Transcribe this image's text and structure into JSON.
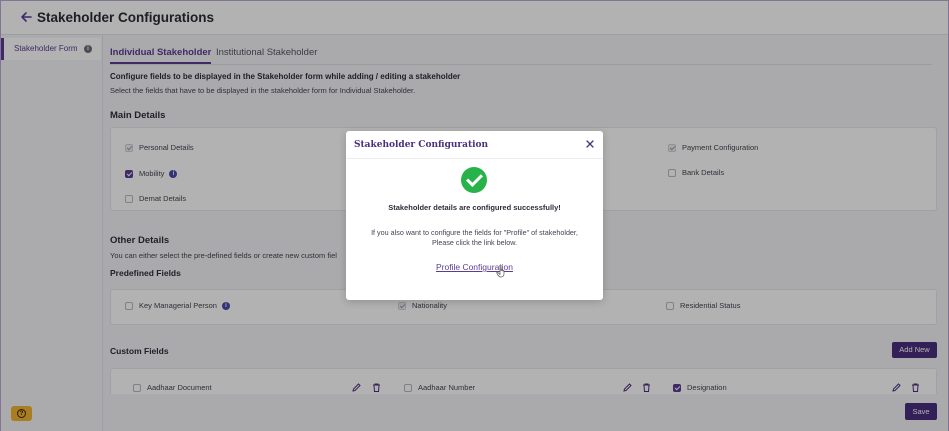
{
  "header": {
    "title": "Stakeholder Configurations"
  },
  "sidebar": {
    "items": [
      {
        "label": "Stakeholder Form"
      }
    ]
  },
  "tabs": [
    {
      "label": "Individual Stakeholder",
      "active": true
    },
    {
      "label": "Institutional Stakeholder",
      "active": false
    }
  ],
  "intro": {
    "title": "Configure fields to be displayed in the Stakeholder form while adding / editing a stakeholder",
    "subtitle": "Select the fields that have to be displayed in the stakeholder form for Individual Stakeholder."
  },
  "main_details": {
    "title": "Main Details",
    "fields": [
      {
        "label": "Personal Details",
        "state": "disabled"
      },
      {
        "label": "Mobility",
        "state": "checked",
        "info": true
      },
      {
        "label": "Demat Details",
        "state": "unchecked"
      },
      {
        "label": "Payment Configuration",
        "state": "disabled"
      },
      {
        "label": "Bank Details",
        "state": "unchecked"
      }
    ]
  },
  "other_details": {
    "title": "Other Details",
    "subtitle": "You can either select the pre-defined fields or create new custom fiel",
    "predefined_title": "Predefined Fields",
    "predefined": [
      {
        "label": "Key Managerial Person",
        "state": "unchecked",
        "info": true
      },
      {
        "label": "Nationality",
        "state": "disabled"
      },
      {
        "label": "Residential Status",
        "state": "unchecked"
      }
    ]
  },
  "custom_fields": {
    "title": "Custom Fields",
    "add_label": "Add New",
    "items": [
      {
        "label": "Aadhaar Document",
        "state": "unchecked"
      },
      {
        "label": "Aadhaar Number",
        "state": "unchecked"
      },
      {
        "label": "Designation",
        "state": "checked"
      }
    ]
  },
  "actions": {
    "save_label": "Save"
  },
  "modal": {
    "title": "Stakeholder Configuration",
    "success_message": "Stakeholder details are configured successfully!",
    "info_line1": "If you also want to configure the fields for \"Profile\" of stakeholder,",
    "info_line2": "Please click the link below.",
    "link_label": "Profile Configuration"
  },
  "colors": {
    "accent": "#5b3c94",
    "button": "#4b2f7f",
    "success": "#27b24a",
    "help": "#f2b531"
  },
  "icons": [
    "back-arrow-icon",
    "info-icon",
    "check-circle-icon",
    "close-icon",
    "edit-icon",
    "trash-icon",
    "help-icon",
    "cursor-icon"
  ]
}
